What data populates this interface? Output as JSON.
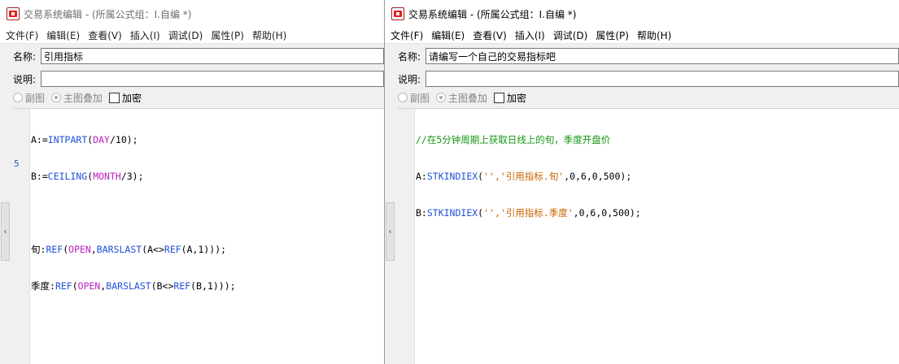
{
  "windows": {
    "left": {
      "title": "交易系统编辑 - (所属公式组：I.自编 *)",
      "menu": [
        "文件(F)",
        "编辑(E)",
        "查看(V)",
        "插入(I)",
        "调试(D)",
        "属性(P)",
        "帮助(H)"
      ],
      "name_label": "名称:",
      "name_value": "引用指标",
      "desc_label": "说明:",
      "desc_value": "",
      "options": {
        "sub_chart": "副图",
        "main_overlay": "主图叠加",
        "encrypt": "加密"
      },
      "line_number_marker": "5",
      "code_lines": [
        "A:=INTPART(DAY/10);",
        "B:=CEILING(MONTH/3);",
        "",
        "旬:REF(OPEN,BARSLAST(A<>REF(A,1)));",
        "季度:REF(OPEN,BARSLAST(B<>REF(B,1)));"
      ]
    },
    "right": {
      "title": "交易系统编辑 - (所属公式组：I.自编 *)",
      "menu": [
        "文件(F)",
        "编辑(E)",
        "查看(V)",
        "插入(I)",
        "调试(D)",
        "属性(P)",
        "帮助(H)"
      ],
      "name_label": "名称:",
      "name_value": "请编写一个自己的交易指标吧",
      "desc_label": "说明:",
      "desc_value": "",
      "options": {
        "sub_chart": "副图",
        "main_overlay": "主图叠加",
        "encrypt": "加密"
      },
      "code_lines": [
        "//在5分钟周期上获取日线上的旬，季度开盘价",
        "A:STKINDIEX('','引用指标.旬',0,6,0,500);",
        "B:STKINDIEX('','引用指标.季度',0,6,0,500);"
      ]
    }
  },
  "splitter_glyph": "‹"
}
